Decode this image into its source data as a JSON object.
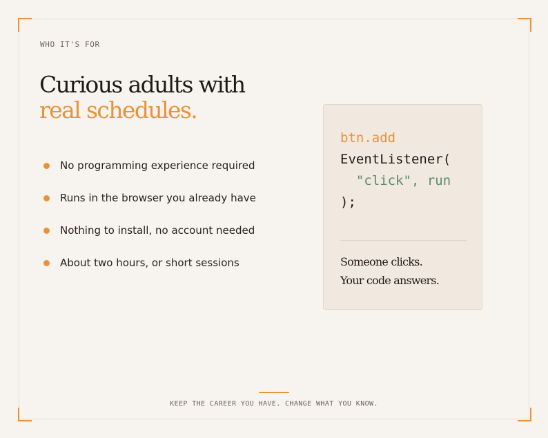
{
  "eyebrow": "WHO IT'S FOR",
  "headline": {
    "line1": "Curious adults with",
    "line2": "real schedules."
  },
  "features": [
    "No programming experience required",
    "Runs in the browser you already have",
    "Nothing to install, no account needed",
    "About two hours, or short sessions"
  ],
  "code_card": {
    "lines": [
      {
        "text": "btn.add",
        "tone": "orange"
      },
      {
        "text": "EventListener(",
        "tone": "dark"
      },
      {
        "text": "  \"click\", run",
        "tone": "green"
      },
      {
        "text": ");",
        "tone": "dark"
      }
    ],
    "caption_line1": "Someone clicks.",
    "caption_line2": "Your code answers."
  },
  "footer": "KEEP THE CAREER YOU HAVE. CHANGE WHAT YOU KNOW.",
  "colors": {
    "accent": "#e8923a",
    "background": "#f7f4ef",
    "card": "#f1e9df",
    "code_green": "#5a8c6e",
    "text": "#1e1a16"
  }
}
